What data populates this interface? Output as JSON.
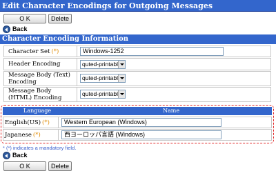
{
  "page": {
    "title": "Edit Character Encodings for Outgoing Messages",
    "ok_label": "O K",
    "delete_label": "Delete",
    "back_label": "Back"
  },
  "section": {
    "title": "Character Encoding Information",
    "mandatory_mark": "(*)",
    "fields": {
      "charset_label": "Character Set",
      "charset_value": "Windows-1252",
      "header_label": "Header Encoding",
      "header_value": "quted-printable",
      "body_text_label": "Message Body (Text) Encoding",
      "body_text_value": "quted-printable",
      "body_html_label": "Message Body (HTML) Encoding",
      "body_html_value": "quted-printable"
    }
  },
  "languages": {
    "col_language": "Language",
    "col_name": "Name",
    "rows": [
      {
        "language": "English(US)",
        "name": "Western European (Windows)"
      },
      {
        "language": "Japanese",
        "name": "西ヨーロッパ言語 (Windows)"
      }
    ]
  },
  "footnote": "* (*) indicates a mandatory field."
}
